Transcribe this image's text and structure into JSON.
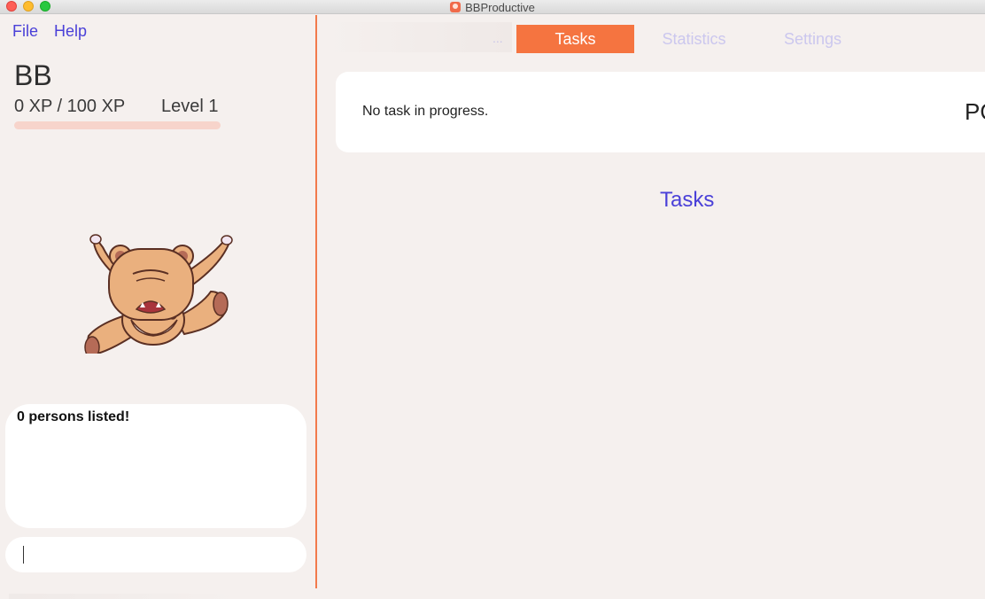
{
  "window": {
    "title": "BBProductive"
  },
  "menu": {
    "file": "File",
    "help": "Help"
  },
  "user": {
    "name": "BB",
    "xp": "0 XP / 100 XP",
    "level": "Level 1",
    "xp_progress": 0.0
  },
  "result": {
    "text": "0 persons listed!"
  },
  "command": {
    "value": "",
    "placeholder": ""
  },
  "tabs": [
    {
      "label": "Tasks",
      "active": true
    },
    {
      "label": "Statistics",
      "active": false
    },
    {
      "label": "Settings",
      "active": false
    }
  ],
  "tabbar": {
    "overflow": "..."
  },
  "progress": {
    "text": "No task in progress.",
    "right_label": "PO"
  },
  "section": {
    "title": "Tasks"
  },
  "colors": {
    "accent": "#f57440",
    "link": "#4a40d8",
    "background": "#f5f0ee"
  },
  "icons": {
    "mascot": "angry-bear-icon",
    "app": "app-logo-icon"
  }
}
